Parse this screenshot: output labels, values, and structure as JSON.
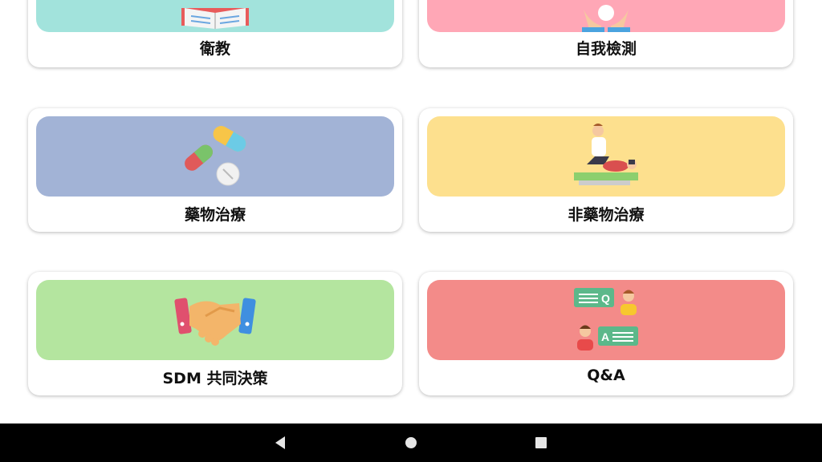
{
  "cards": [
    {
      "label": "衛教",
      "color": "#a2e3dc",
      "icon": "open-book-icon"
    },
    {
      "label": "自我檢測",
      "color": "#ffa7b6",
      "icon": "hands-icon"
    },
    {
      "label": "藥物治療",
      "color": "#a2b3d6",
      "icon": "pills-icon"
    },
    {
      "label": "非藥物治療",
      "color": "#fde08e",
      "icon": "physiotherapy-icon"
    },
    {
      "label": "SDM 共同決策",
      "color": "#b4e59f",
      "icon": "handshake-icon"
    },
    {
      "label": "Q&A",
      "color": "#f38b89",
      "icon": "qa-chat-icon"
    }
  ],
  "navbar": {
    "back": "back-triangle-icon",
    "home": "home-circle-icon",
    "recents": "recents-square-icon"
  }
}
